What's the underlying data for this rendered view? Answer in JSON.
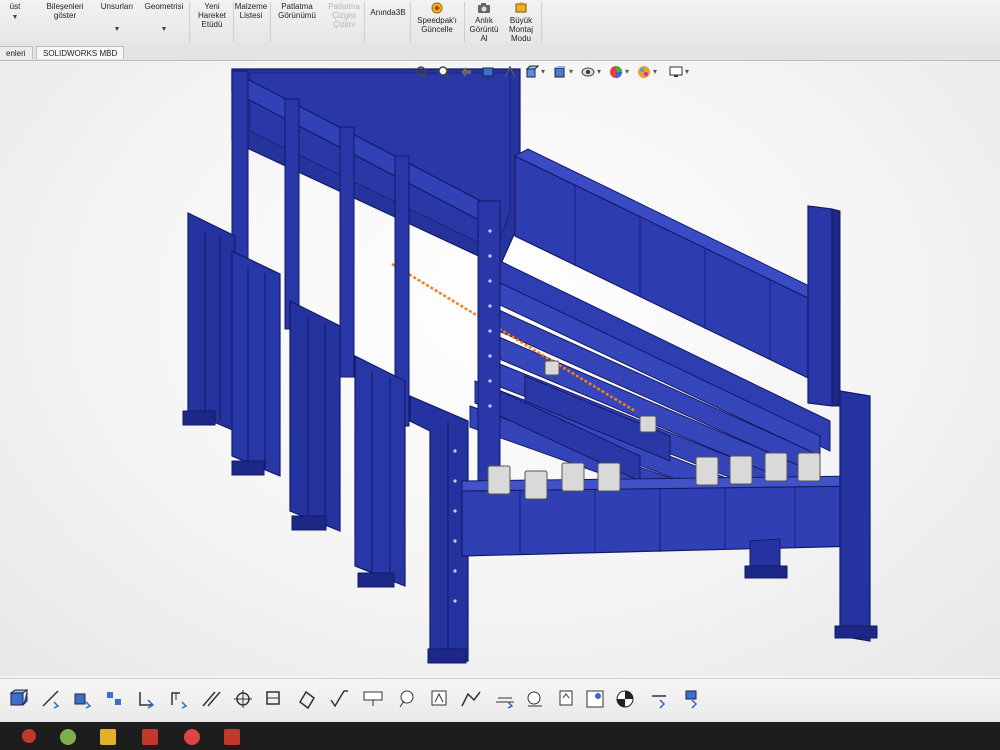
{
  "ribbon": {
    "items": [
      {
        "label": "üst",
        "caret": "▼"
      },
      {
        "label": "Bileşenleri\ngöster",
        "caret": ""
      },
      {
        "label": "Unsurları",
        "caret": "▼"
      },
      {
        "label": "Geometrisi",
        "caret": "▼"
      },
      {
        "label": "Yeni\nHareket\nEtüdü",
        "caret": ""
      },
      {
        "label": "Malzeme\nListesi",
        "caret": ""
      },
      {
        "label": "Patlatma\nGörünümü",
        "caret": ""
      },
      {
        "label": "Patlatma\nÇizgisi\nÇizimi",
        "caret": ""
      },
      {
        "label": "Anında3B",
        "caret": ""
      },
      {
        "label": "Speedpak'ı\nGüncelle",
        "caret": ""
      },
      {
        "label": "Anlık\nGörüntü\nAl",
        "caret": ""
      },
      {
        "label": "Büyük\nMontaj\nModu",
        "caret": ""
      }
    ]
  },
  "tabs": [
    {
      "label": "enleri"
    },
    {
      "label": "SOLIDWORKS MBD"
    }
  ],
  "heads_up_toolbar": {
    "icons": [
      "zoom-to-fit-icon",
      "zoom-area-icon",
      "previous-view-icon",
      "section-view-icon",
      "dynamic-annotation-icon",
      "view-orientation-icon",
      "display-style-icon",
      "hide-show-items-icon",
      "edit-appearance-icon",
      "apply-scene-icon",
      "view-settings-icon"
    ]
  },
  "bottom_toolbar": {
    "icons": [
      "insert-components-icon",
      "smart-dimension-icon",
      "mate-icon",
      "linear-pattern-icon",
      "datum-feature-icon",
      "datum-target-icon",
      "basic-dimension-icon",
      "location-dimension-icon",
      "size-dimension-icon",
      "geometric-tolerance-icon",
      "surface-finish-icon",
      "weld-symbol-icon",
      "note-icon",
      "balloon-icon",
      "auto-balloon-icon",
      "datum-symbol-icon",
      "hole-callout-icon",
      "center-mark-icon",
      "ordinate-icon",
      "bom-table-icon",
      "publish-icon",
      "capture-icon"
    ]
  },
  "model": {
    "name": "steel-frame-assembly",
    "color": "#2f3fae",
    "highlight_color": "#ff7a1a"
  }
}
